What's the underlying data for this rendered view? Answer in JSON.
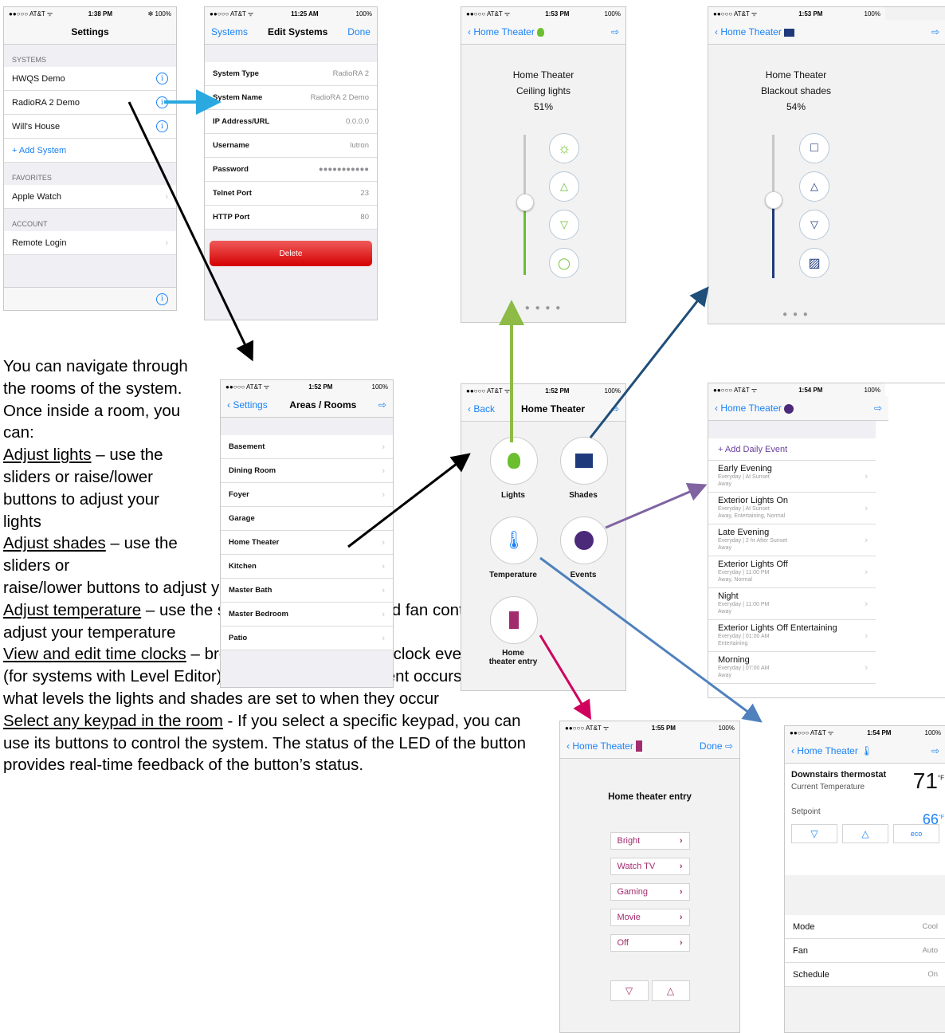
{
  "status": {
    "carrier": "●●○○○ AT&T ᯤ",
    "battery": "100%"
  },
  "settings": {
    "time": "1:38 PM",
    "title": "Settings",
    "battery": "✻ 100%",
    "sys_hdr": "SYSTEMS",
    "systems": [
      "HWQS Demo",
      "RadioRA 2 Demo",
      "Will's House"
    ],
    "add": "+ Add System",
    "fav_hdr": "FAVORITES",
    "fav": "Apple Watch",
    "acct_hdr": "ACCOUNT",
    "acct": "Remote Login",
    "info": "i"
  },
  "edit": {
    "time": "11:25 AM",
    "back": "Systems",
    "title": "Edit Systems",
    "done": "Done",
    "fields": [
      {
        "label": "System Type",
        "value": "RadioRA 2"
      },
      {
        "label": "System Name",
        "value": "RadioRA 2 Demo"
      },
      {
        "label": "IP Address/URL",
        "value": "0.0.0.0"
      },
      {
        "label": "Username",
        "value": "lutron"
      },
      {
        "label": "Password",
        "value": "●●●●●●●●●●●"
      },
      {
        "label": "Telnet Port",
        "value": "23"
      },
      {
        "label": "HTTP Port",
        "value": "80"
      }
    ],
    "delete": "Delete"
  },
  "lights": {
    "time": "1:53 PM",
    "back": "Home Theater",
    "room": "Home Theater",
    "name": "Ceiling lights",
    "level": "51%",
    "level_value": 0.51,
    "dots": "● ● ● ●"
  },
  "shades": {
    "time": "1:53 PM",
    "back": "Home Theater",
    "room": "Home Theater",
    "name": "Blackout shades",
    "level": "54%",
    "level_value": 0.54,
    "dots": "● ● ●"
  },
  "areas": {
    "time": "1:52 PM",
    "back": "Settings",
    "title": "Areas / Rooms",
    "rooms": [
      "Basement",
      "Dining Room",
      "Foyer",
      "Garage",
      "Home Theater",
      "Kitchen",
      "Master Bath",
      "Master Bedroom",
      "Patio"
    ]
  },
  "room": {
    "time": "1:52 PM",
    "back": "Back",
    "title": "Home Theater",
    "lights": "Lights",
    "shades": "Shades",
    "temperature": "Temperature",
    "events": "Events",
    "entry": "Home\ntheater entry"
  },
  "events": {
    "time": "1:54 PM",
    "back": "Home Theater",
    "add": "+ Add Daily Event",
    "items": [
      {
        "name": "Early Evening",
        "sub1": "Everyday | At Sunset",
        "sub2": "Away"
      },
      {
        "name": "Exterior Lights On",
        "sub1": "Everyday | At Sunset",
        "sub2": "Away, Entertaining, Normal"
      },
      {
        "name": "Late Evening",
        "sub1": "Everyday | 2 hr After Sunset",
        "sub2": "Away"
      },
      {
        "name": "Exterior Lights Off",
        "sub1": "Everyday | 11:00 PM",
        "sub2": "Away, Normal"
      },
      {
        "name": "Night",
        "sub1": "Everyday | 11:00 PM",
        "sub2": "Away"
      },
      {
        "name": "Exterior Lights Off Entertaining",
        "sub1": "Everyday | 01:00 AM",
        "sub2": "Entertaining"
      },
      {
        "name": "Morning",
        "sub1": "Everyday | 07:00 AM",
        "sub2": "Away"
      }
    ]
  },
  "keypad": {
    "time": "1:55 PM",
    "back": "Home Theater",
    "done": "Done",
    "title": "Home theater entry",
    "buttons": [
      "Bright",
      "Watch TV",
      "Gaming",
      "Movie",
      "Off"
    ]
  },
  "thermo": {
    "time": "1:54 PM",
    "back": "Home Theater",
    "name": "Downstairs thermostat",
    "current_label": "Current Temperature",
    "current": "71",
    "unit": "°F",
    "setpoint_label": "Setpoint",
    "setpoint": "66",
    "eco": "eco",
    "mode_label": "Mode",
    "mode": "Cool",
    "fan_label": "Fan",
    "fan": "Auto",
    "schedule_label": "Schedule",
    "schedule": "On"
  },
  "description": {
    "intro": "You can navigate through the rooms of the system. Once inside a room, you can:",
    "h1": "Adjust lights",
    "t1": " – use the sliders or raise/lower buttons to adjust your lights",
    "h2": "Adjust shades",
    "t2": " – use the sliders or raise/lower buttons to adjust your shades",
    "h3": "Adjust temperature",
    "t3": " – use the set point, mode, eco, and fan controls to adjust your temperature",
    "h4": "View and edit time clocks",
    "t4": " – browse through your time clock events and (for systems with Level Editor) modify the time the event occurs and what levels the lights and shades are set to when they occur",
    "h5": "Select any keypad in the room",
    "t5": " - If you select a specific keypad, you can use its buttons to control the system. The status of the LED of the button provides real-time feedback of the button’s status."
  }
}
